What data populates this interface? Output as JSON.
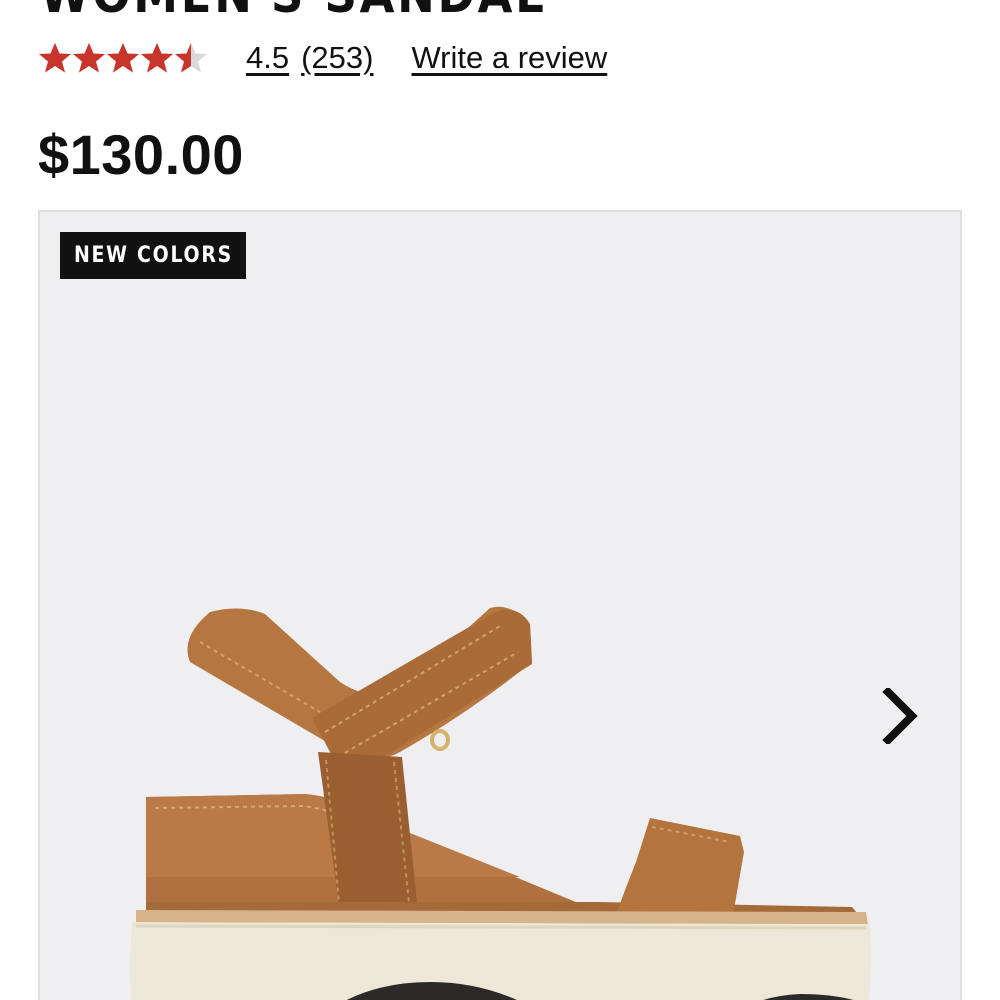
{
  "product": {
    "title": "WOMEN'S SANDAL",
    "price": "$130.00"
  },
  "rating": {
    "stars": 4.5,
    "value_label": "4.5",
    "count_label": "(253)",
    "write_review_label": "Write a review",
    "star_color": "#c8352a"
  },
  "gallery": {
    "badge_label": "NEW COLORS",
    "next_icon": "chevron-right-icon",
    "image_subject": "sandal"
  }
}
